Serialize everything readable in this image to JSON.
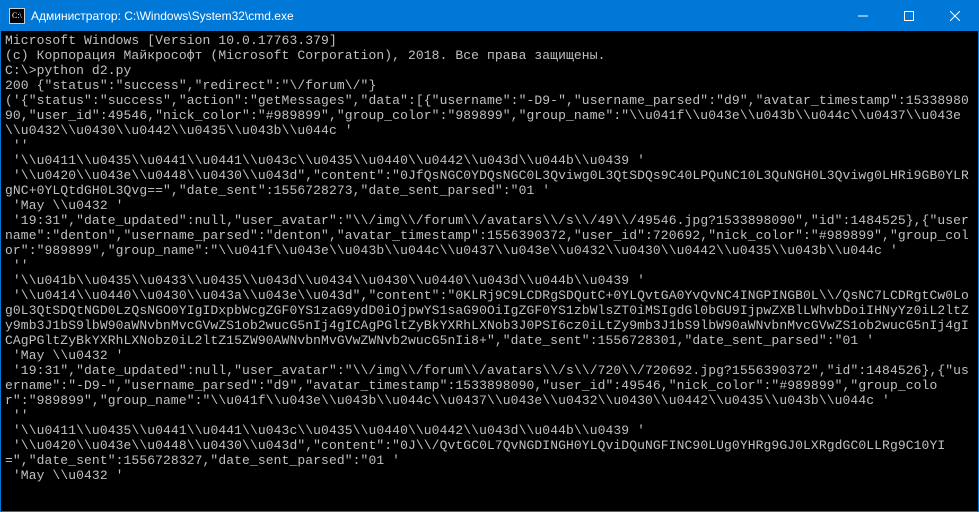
{
  "window": {
    "title": "Администратор: C:\\Windows\\System32\\cmd.exe",
    "icon": "cmd-icon"
  },
  "controls": {
    "minimize": "—",
    "maximize": "☐",
    "close": "✕"
  },
  "terminal": {
    "lines": [
      "Microsoft Windows [Version 10.0.17763.379]",
      "(c) Корпорация Майкрософт (Microsoft Corporation), 2018. Все права защищены.",
      "",
      "C:\\>python d2.py",
      "200 {\"status\":\"success\",\"redirect\":\"\\/forum\\/\"}",
      "('{\"status\":\"success\",\"action\":\"getMessages\",\"data\":[{\"username\":\"-D9-\",\"username_parsed\":\"d9\",\"avatar_timestamp\":1533898090,\"user_id\":49546,\"nick_color\":\"#989899\",\"group_color\":\"989899\",\"group_name\":\"\\\\u041f\\\\u043e\\\\u043b\\\\u044c\\\\u0437\\\\u043e\\\\u0432\\\\u0430\\\\u0442\\\\u0435\\\\u043b\\\\u044c '",
      " ''",
      " '\\\\u0411\\\\u0435\\\\u0441\\\\u0441\\\\u043c\\\\u0435\\\\u0440\\\\u0442\\\\u043d\\\\u044b\\\\u0439 '",
      " '\\\\u0420\\\\u043e\\\\u0448\\\\u0430\\\\u043d\",\"content\":\"0JfQsNGC0YDQsNGC0L3Qviwg0L3QtSDQs9C40LPQuNC10L3QuNGH0L3Qviwg0LHRi9GB0YLRgNC+0YLQtdGH0L3Qvg==\",\"date_sent\":1556728273,\"date_sent_parsed\":\"01 '",
      " 'May \\\\u0432 '",
      " '19:31\",\"date_updated\":null,\"user_avatar\":\"\\\\/img\\\\/forum\\\\/avatars\\\\/s\\\\/49\\\\/49546.jpg?1533898090\",\"id\":1484525},{\"username\":\"denton\",\"username_parsed\":\"denton\",\"avatar_timestamp\":1556390372,\"user_id\":720692,\"nick_color\":\"#989899\",\"group_color\":\"989899\",\"group_name\":\"\\\\u041f\\\\u043e\\\\u043b\\\\u044c\\\\u0437\\\\u043e\\\\u0432\\\\u0430\\\\u0442\\\\u0435\\\\u043b\\\\u044c '",
      " ''",
      " '\\\\u041b\\\\u0435\\\\u0433\\\\u0435\\\\u043d\\\\u0434\\\\u0430\\\\u0440\\\\u043d\\\\u044b\\\\u0439 '",
      " '\\\\u0414\\\\u0440\\\\u0430\\\\u043a\\\\u043e\\\\u043d\",\"content\":\"0KLRj9C9LCDRgSDQutC+0YLQvtGA0YvQvNC4INGPINGB0L\\\\/QsNC7LCDRgtCw0Log0L3QtSDQtNGD0LzQsNGO0YIgIDxpbWcgZGF0YS1zaG9ydD0iOjpwYS1saG90OiIgZGF0YS1zbWlsZT0iMSIgdGl0bGU9IjpwZXBlLWhvbDoiIHNyYz0iL2ltZy9mb3J1bS9lbW90aWNvbnMvcGVwZS1ob2wucG5nIj4gICAgPGltZyBkYXRhLXNob3J0PSI6cz0iLtZy9mb3J1bS9lbW90aWNvbnMvcGVwZS1ob2wucG5nIj4gICAgPGltZyBkYXRhLXNobz0iL2ltZ15ZW90AWNvbnMvGVwZWNvb2wucG5nIi8+\",\"date_sent\":1556728301,\"date_sent_parsed\":\"01 '",
      " 'May \\\\u0432 '",
      " '19:31\",\"date_updated\":null,\"user_avatar\":\"\\\\/img\\\\/forum\\\\/avatars\\\\/s\\\\/720\\\\/720692.jpg?1556390372\",\"id\":1484526},{\"username\":\"-D9-\",\"username_parsed\":\"d9\",\"avatar_timestamp\":1533898090,\"user_id\":49546,\"nick_color\":\"#989899\",\"group_color\":\"989899\",\"group_name\":\"\\\\u041f\\\\u043e\\\\u043b\\\\u044c\\\\u0437\\\\u043e\\\\u0432\\\\u0430\\\\u0442\\\\u0435\\\\u043b\\\\u044c '",
      " ''",
      " '\\\\u0411\\\\u0435\\\\u0441\\\\u0441\\\\u043c\\\\u0435\\\\u0440\\\\u0442\\\\u043d\\\\u044b\\\\u0439 '",
      " '\\\\u0420\\\\u043e\\\\u0448\\\\u0430\\\\u043d\",\"content\":\"0J\\\\/QvtGC0L7QvNGDINGH0YLQviDQuNGFINC90LUg0YHRg9GJ0LXRgdGC0LLRg9C10YI=\",\"date_sent\":1556728327,\"date_sent_parsed\":\"01 '",
      " 'May \\\\u0432 '"
    ]
  }
}
